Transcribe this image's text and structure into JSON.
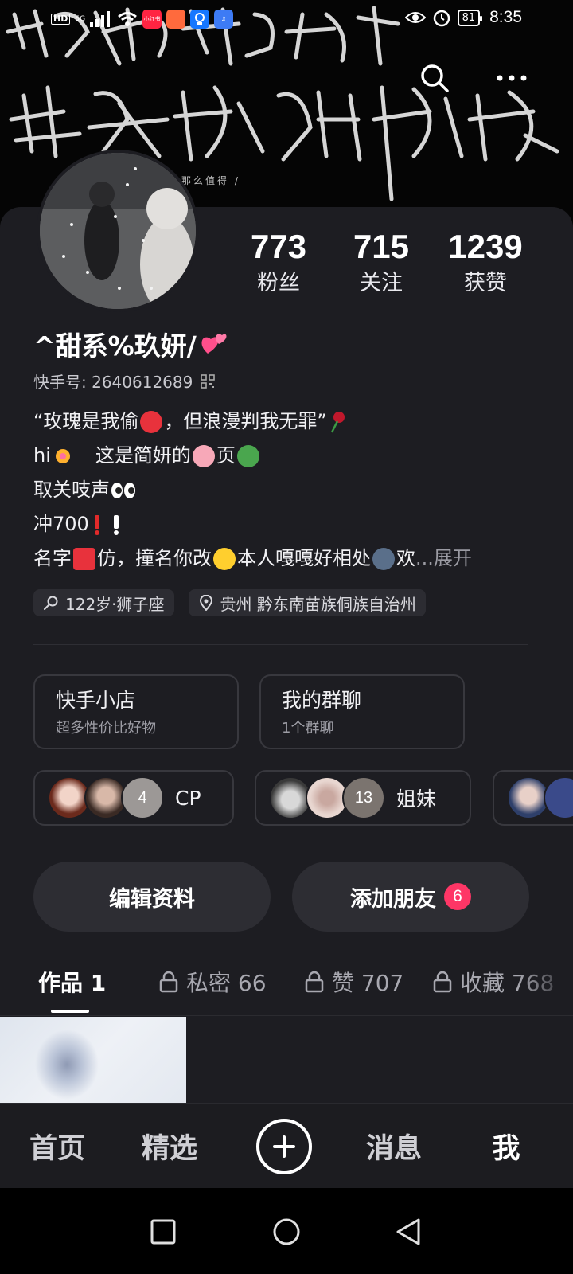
{
  "status_bar": {
    "hd": "HD",
    "signal": "5G",
    "apps": [
      "小红书",
      "",
      "",
      ""
    ],
    "battery": "81",
    "time": "8:35"
  },
  "banner": {
    "line1": "别来趟我这趟浑水",
    "line2": "其实我没有你想的那么值得",
    "small_tag": "那么值得 /"
  },
  "profile": {
    "stats": [
      {
        "value": "773",
        "label": "粉丝"
      },
      {
        "value": "715",
        "label": "关注"
      },
      {
        "value": "1239",
        "label": "获赞"
      }
    ],
    "nickname": "^甜系%玖妍/",
    "uid": "快手号: 2640612689",
    "bio": {
      "l1a": "“玫瑰是我偷",
      "l1b": "，但浪漫判我无罪”",
      "l2a": "hi",
      "l2b": "这是简妍的",
      "l2c": "页",
      "l3": "取关吱声",
      "l4": "冲700",
      "l5a": "名字",
      "l5b": "仿，撞名你改",
      "l5c": " 本人嘎嘎好相处",
      "l5d": " 欢",
      "expand": "...展开"
    },
    "tags": [
      "122岁·狮子座",
      "贵州 黔东南苗族侗族自治州"
    ]
  },
  "features": [
    {
      "title": "快手小店",
      "sub": "超多性价比好物"
    },
    {
      "title": "我的群聊",
      "sub": "1个群聊"
    }
  ],
  "groups": [
    {
      "count": "4",
      "label": "CP"
    },
    {
      "count": "13",
      "label": "姐妹"
    }
  ],
  "actions": {
    "edit": "编辑资料",
    "add_friend": "添加朋友",
    "add_friend_badge": "6"
  },
  "tabs": [
    {
      "label": "作品 1"
    },
    {
      "label": "私密 66"
    },
    {
      "label": "赞 707"
    },
    {
      "label": "收藏 768"
    }
  ],
  "bottom_nav": [
    "首页",
    "精选",
    "消息",
    "我"
  ],
  "colors": {
    "badge": "#fe3666",
    "card": "#1d1d22",
    "accent_pink": "#ff4f8b"
  }
}
